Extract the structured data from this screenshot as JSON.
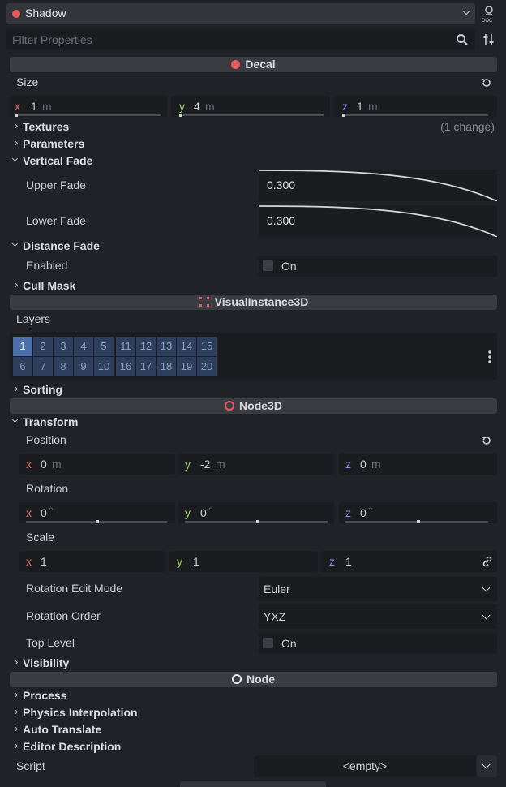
{
  "header": {
    "node_name": "Shadow",
    "node_color": "#e45a5a"
  },
  "filter": {
    "placeholder": "Filter Properties"
  },
  "sections": {
    "decal": "Decal",
    "visual_instance": "VisualInstance3D",
    "node3d": "Node3D",
    "node": "Node"
  },
  "decal": {
    "size_label": "Size",
    "size": {
      "x": "1",
      "y": "4",
      "z": "1",
      "unit": "m"
    },
    "textures": "Textures",
    "textures_change": "(1 change)",
    "parameters": "Parameters",
    "vertical_fade": "Vertical Fade",
    "upper_fade_label": "Upper Fade",
    "upper_fade_value": "0.300",
    "lower_fade_label": "Lower Fade",
    "lower_fade_value": "0.300",
    "distance_fade": "Distance Fade",
    "enabled_label": "Enabled",
    "enabled_value": "On",
    "cull_mask": "Cull Mask"
  },
  "visual": {
    "layers_label": "Layers",
    "layers_row1": [
      "1",
      "2",
      "3",
      "4",
      "5",
      "11",
      "12",
      "13",
      "14",
      "15"
    ],
    "layers_row2": [
      "6",
      "7",
      "8",
      "9",
      "10",
      "16",
      "17",
      "18",
      "19",
      "20"
    ],
    "sorting": "Sorting"
  },
  "node3d": {
    "transform": "Transform",
    "position_label": "Position",
    "position": {
      "x": "0",
      "y": "-2",
      "z": "0",
      "unit": "m"
    },
    "rotation_label": "Rotation",
    "rotation": {
      "x": "0",
      "y": "0",
      "z": "0",
      "unit": "°"
    },
    "scale_label": "Scale",
    "scale": {
      "x": "1",
      "y": "1",
      "z": "1"
    },
    "rotation_edit_mode_label": "Rotation Edit Mode",
    "rotation_edit_mode_value": "Euler",
    "rotation_order_label": "Rotation Order",
    "rotation_order_value": "YXZ",
    "top_level_label": "Top Level",
    "top_level_value": "On",
    "visibility": "Visibility"
  },
  "node": {
    "process": "Process",
    "physics_interpolation": "Physics Interpolation",
    "auto_translate": "Auto Translate",
    "editor_description": "Editor Description",
    "script_label": "Script",
    "script_value": "<empty>"
  }
}
